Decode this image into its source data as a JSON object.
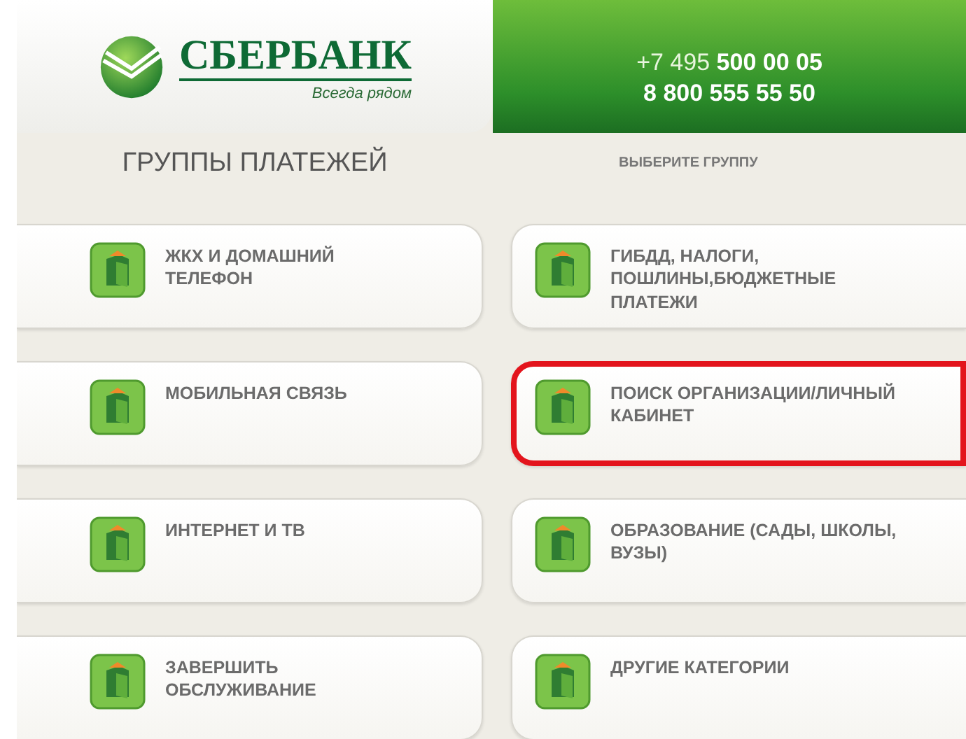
{
  "header": {
    "logo_text": "СБЕРБАНК",
    "slogan": "Всегда рядом",
    "phones": [
      {
        "prefix": "+7 495 ",
        "number": "500 00 05"
      },
      {
        "number": "8 800 555 55 50"
      }
    ]
  },
  "title_bar": {
    "title": "ГРУППЫ ПЛАТЕЖЕЙ",
    "hint": "ВЫБЕРИТЕ ГРУППУ"
  },
  "buttons": [
    {
      "label": "ЖКХ И ДОМАШНИЙ ТЕЛЕФОН",
      "highlighted": false
    },
    {
      "label": "ГИБДД, НАЛОГИ, ПОШЛИНЫ,БЮДЖЕТНЫЕ ПЛАТЕЖИ",
      "highlighted": false
    },
    {
      "label": "МОБИЛЬНАЯ СВЯЗЬ",
      "highlighted": false
    },
    {
      "label": "ПОИСК ОРГАНИЗАЦИИ/ЛИЧНЫЙ КАБИНЕТ",
      "highlighted": true
    },
    {
      "label": "ИНТЕРНЕТ И ТВ",
      "highlighted": false
    },
    {
      "label": "ОБРАЗОВАНИЕ (САДЫ, ШКОЛЫ, ВУЗЫ)",
      "highlighted": false
    },
    {
      "label": "ЗАВЕРШИТЬ ОБСЛУЖИВАНИЕ",
      "highlighted": false
    },
    {
      "label": "ДРУГИЕ КАТЕГОРИИ",
      "highlighted": false
    }
  ]
}
